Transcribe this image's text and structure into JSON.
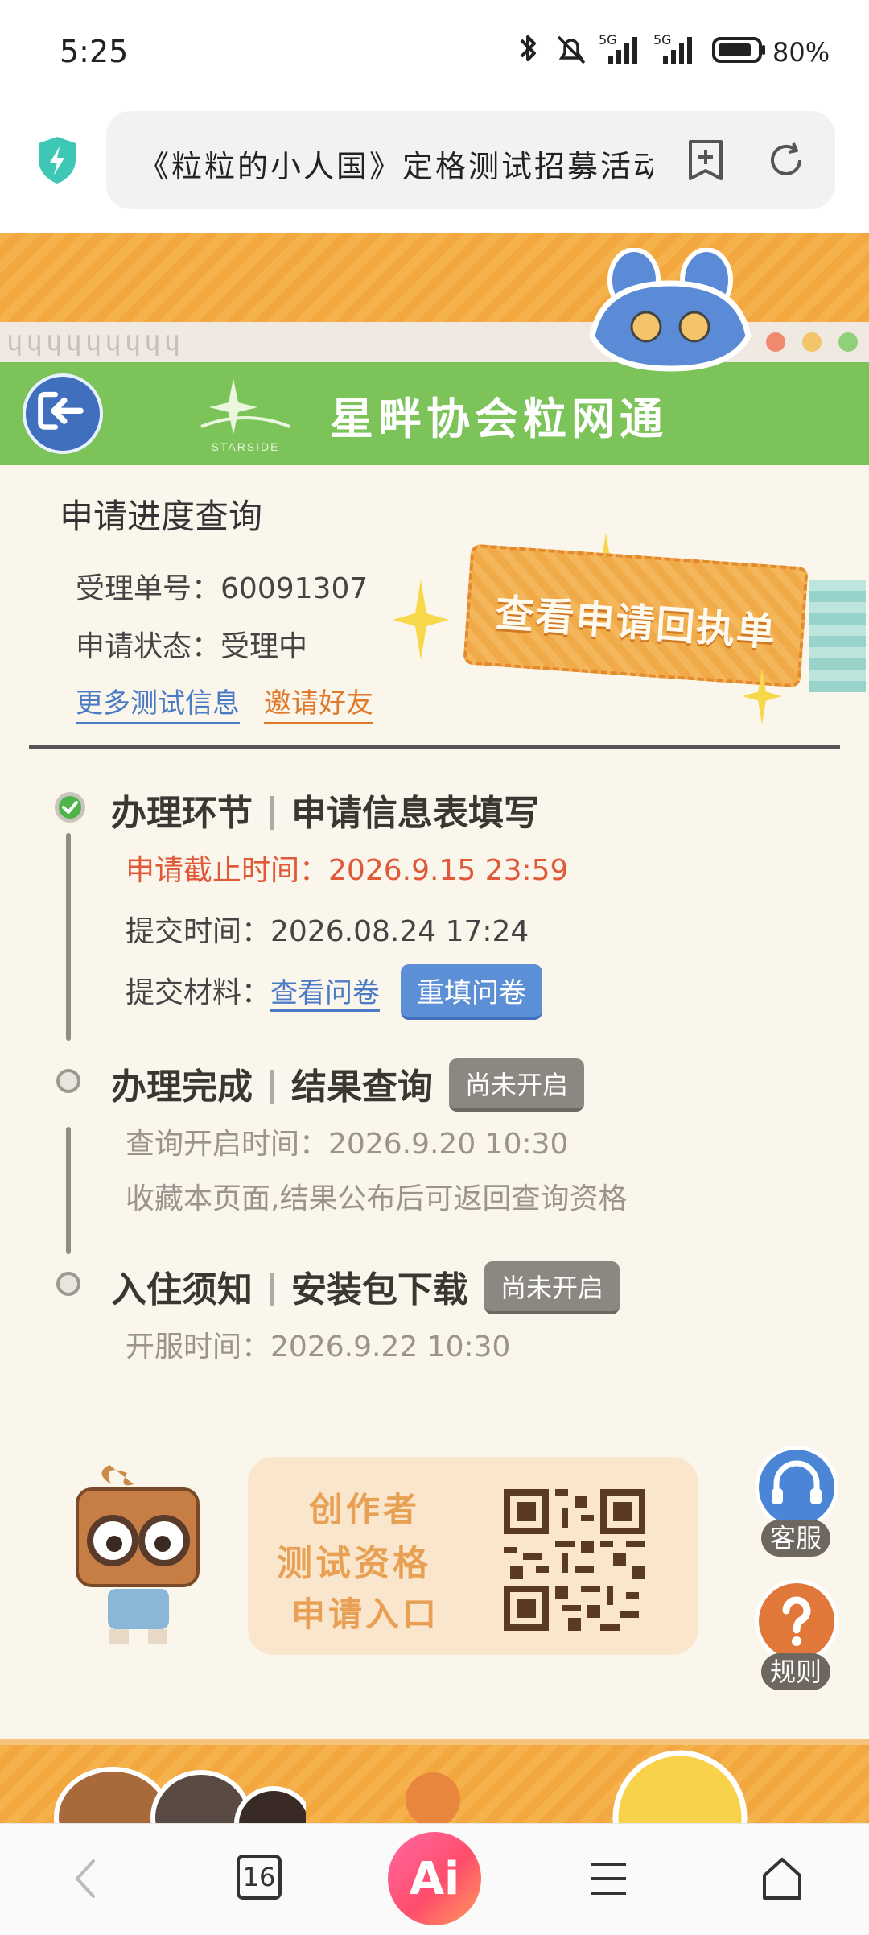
{
  "status_bar": {
    "time": "5:25",
    "battery": "80%",
    "net1": "5G",
    "net2": "5G"
  },
  "url_bar": {
    "title": "《粒粒的小人国》定格测试招募活动"
  },
  "header": {
    "ribbon_text": "ɥɥɥɥɥɥɥɥɥ",
    "logo_text": "STARSIDE",
    "title": "星畔协会粒网通"
  },
  "progress": {
    "title": "申请进度查询",
    "order_label": "受理单号：",
    "order_value": "60091307",
    "status_label": "申请状态：",
    "status_value": "受理中",
    "link_more": "更多测试信息",
    "link_invite": "邀请好友",
    "receipt_button": "查看申请回执单"
  },
  "steps": [
    {
      "title": "办理环节",
      "subtitle": "申请信息表填写",
      "deadline_label": "申请截止时间：",
      "deadline_value": "2026.9.15   23:59",
      "submit_time_label": "提交时间：",
      "submit_time_value": "2026.08.24  17:24",
      "materials_label": "提交材料：",
      "view_questionnaire": "查看问卷",
      "refill_questionnaire": "重填问卷"
    },
    {
      "title": "办理完成",
      "subtitle": "结果查询",
      "tag": "尚未开启",
      "open_time_label": "查询开启时间：",
      "open_time_value": "2026.9.20   10:30",
      "note": "收藏本页面,结果公布后可返回查询资格"
    },
    {
      "title": "入住须知",
      "subtitle": "安装包下载",
      "tag": "尚未开启",
      "server_time_label": "开服时间：",
      "server_time_value": "2026.9.22   10:30"
    }
  ],
  "promo": {
    "line1": "创作者",
    "line2": "测试资格",
    "line3": "申请入口"
  },
  "float_buttons": {
    "service": "客服",
    "rules": "规则"
  },
  "bottom_nav": {
    "tabs_count": "16",
    "ai_label": "Ai"
  },
  "colors": {
    "green": "#7cc35a",
    "orange": "#f5b14c",
    "blue": "#3f6fbd",
    "red": "#e05a3a"
  }
}
